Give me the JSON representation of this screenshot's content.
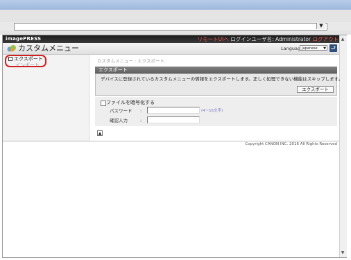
{
  "browser": {
    "address_value": "",
    "dropdown_icon": "chevron-down-icon"
  },
  "header": {
    "logo": "imagePRESS",
    "remote_ui_link": "リモートUIへ",
    "login_user": "ログインユーザ名: Administrator",
    "logout_link": "ログアウト"
  },
  "title_band": {
    "page_title": "カスタムメニュー",
    "language_label": "Language:",
    "language_value": "Japanese",
    "go_icon": "return-arrow-icon"
  },
  "sidebar": {
    "items": [
      {
        "label": "エクスポート",
        "selected": true
      },
      {
        "label": "インポート",
        "selected": false
      }
    ],
    "highlight_color": "#d22020"
  },
  "main": {
    "breadcrumb": "カスタムメニュー : エクスポート",
    "section_title": "エクスポート",
    "description": "デバイスに登録されているカスタムメニューの情報をエクスポートします。正しく処理できない機能はスキップします。",
    "export_button": "エクスポート",
    "encrypt_label": "ファイルを暗号化する",
    "encrypt_checked": false,
    "password_label": "パスワード",
    "colon": ":",
    "password_value": "",
    "password_hint": "(4～16文字)",
    "confirm_label": "確認入力",
    "confirm_value": "",
    "top_icon": "to-top-icon"
  },
  "footer": {
    "copyright": "Copyright CANON INC. 2016 All Rights Reserved"
  }
}
